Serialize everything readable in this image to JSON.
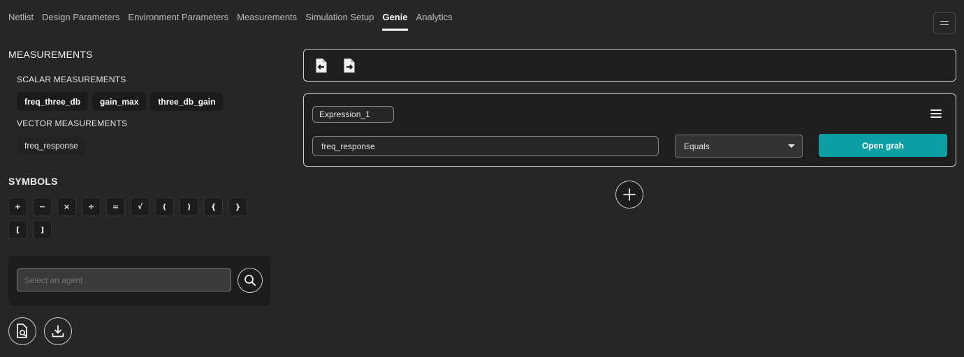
{
  "tabs": [
    {
      "label": "Netlist",
      "active": false
    },
    {
      "label": "Design Parameters",
      "active": false
    },
    {
      "label": "Environment Parameters",
      "active": false
    },
    {
      "label": "Measurements",
      "active": false
    },
    {
      "label": "Simulation Setup",
      "active": false
    },
    {
      "label": "Genie",
      "active": true
    },
    {
      "label": "Analytics",
      "active": false
    }
  ],
  "left": {
    "measurements_heading": "MEASUREMENTS",
    "scalar_heading": "SCALAR MEASUREMENTS",
    "scalar_items": [
      "freq_three_db",
      "gain_max",
      "three_db_gain"
    ],
    "vector_heading": "VECTOR MEASUREMENTS",
    "vector_items": [
      "freq_response"
    ],
    "symbols_heading": "SYMBOLS",
    "symbols": [
      "+",
      "−",
      "×",
      "÷",
      "=",
      "√",
      "(",
      ")",
      "{",
      "}",
      "[",
      "]"
    ],
    "agent_placeholder": "Select an agent"
  },
  "expression": {
    "name": "Expression_1",
    "value": "freq_response",
    "operator": "Equals",
    "action_label": "Open grah"
  },
  "colors": {
    "background": "#262626",
    "card": "#1e1e1e",
    "accent": "#0b9ea2"
  },
  "icons": {
    "import": "file-import-icon",
    "export": "file-export-icon",
    "search": "search-icon",
    "file_search": "file-search-icon",
    "download": "download-icon",
    "add": "plus-icon",
    "menu": "hamburger-menu-icon"
  }
}
